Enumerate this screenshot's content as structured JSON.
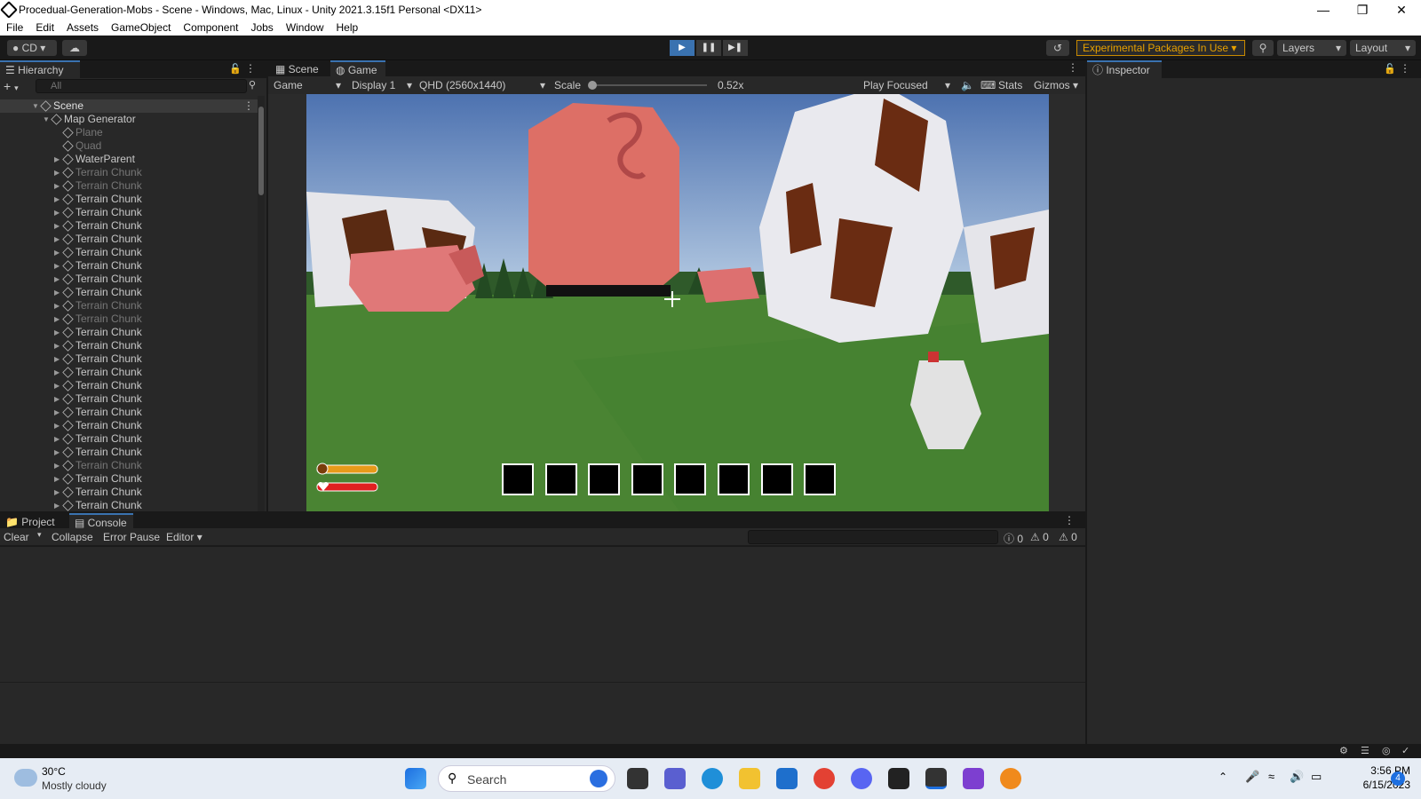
{
  "window": {
    "title": "Procedual-Generation-Mobs - Scene - Windows, Mac, Linux - Unity 2021.3.15f1 Personal <DX11>"
  },
  "menu": [
    "File",
    "Edit",
    "Assets",
    "GameObject",
    "Component",
    "Jobs",
    "Window",
    "Help"
  ],
  "toolbar": {
    "account": "CD",
    "experimental": "Experimental Packages In Use",
    "layers": "Layers",
    "layout": "Layout"
  },
  "hierarchy": {
    "tab": "Hierarchy",
    "search_placeholder": "All",
    "scene": "Scene",
    "items": [
      {
        "label": "Map Generator",
        "depth": 1,
        "expanded": true,
        "dim": false
      },
      {
        "label": "Plane",
        "depth": 2,
        "dim": true
      },
      {
        "label": "Quad",
        "depth": 2,
        "dim": true
      },
      {
        "label": "WaterParent",
        "depth": 2,
        "dim": false
      },
      {
        "label": "Terrain Chunk",
        "depth": 2,
        "dim": true
      },
      {
        "label": "Terrain Chunk",
        "depth": 2,
        "dim": true
      },
      {
        "label": "Terrain Chunk",
        "depth": 2,
        "dim": false
      },
      {
        "label": "Terrain Chunk",
        "depth": 2,
        "dim": false
      },
      {
        "label": "Terrain Chunk",
        "depth": 2,
        "dim": false
      },
      {
        "label": "Terrain Chunk",
        "depth": 2,
        "dim": false
      },
      {
        "label": "Terrain Chunk",
        "depth": 2,
        "dim": false
      },
      {
        "label": "Terrain Chunk",
        "depth": 2,
        "dim": false
      },
      {
        "label": "Terrain Chunk",
        "depth": 2,
        "dim": false
      },
      {
        "label": "Terrain Chunk",
        "depth": 2,
        "dim": false
      },
      {
        "label": "Terrain Chunk",
        "depth": 2,
        "dim": true
      },
      {
        "label": "Terrain Chunk",
        "depth": 2,
        "dim": true
      },
      {
        "label": "Terrain Chunk",
        "depth": 2,
        "dim": false
      },
      {
        "label": "Terrain Chunk",
        "depth": 2,
        "dim": false
      },
      {
        "label": "Terrain Chunk",
        "depth": 2,
        "dim": false
      },
      {
        "label": "Terrain Chunk",
        "depth": 2,
        "dim": false
      },
      {
        "label": "Terrain Chunk",
        "depth": 2,
        "dim": false
      },
      {
        "label": "Terrain Chunk",
        "depth": 2,
        "dim": false
      },
      {
        "label": "Terrain Chunk",
        "depth": 2,
        "dim": false
      },
      {
        "label": "Terrain Chunk",
        "depth": 2,
        "dim": false
      },
      {
        "label": "Terrain Chunk",
        "depth": 2,
        "dim": false
      },
      {
        "label": "Terrain Chunk",
        "depth": 2,
        "dim": false
      },
      {
        "label": "Terrain Chunk",
        "depth": 2,
        "dim": true
      },
      {
        "label": "Terrain Chunk",
        "depth": 2,
        "dim": false
      },
      {
        "label": "Terrain Chunk",
        "depth": 2,
        "dim": false
      },
      {
        "label": "Terrain Chunk",
        "depth": 2,
        "dim": false
      }
    ]
  },
  "center_tabs": {
    "scene": "Scene",
    "game": "Game"
  },
  "gamebar": {
    "mode": "Game",
    "display": "Display 1",
    "resolution": "QHD (2560x1440)",
    "scale_label": "Scale",
    "scale_value": "0.52x",
    "play_focused": "Play Focused",
    "stats": "Stats",
    "gizmos": "Gizmos"
  },
  "inspector": {
    "tab": "Inspector"
  },
  "bottom_tabs": {
    "project": "Project",
    "console": "Console"
  },
  "console": {
    "clear": "Clear",
    "collapse": "Collapse",
    "error_pause": "Error Pause",
    "editor": "Editor",
    "log_count": "0",
    "warn_count": "0",
    "error_count": "0"
  },
  "hud": {
    "hunger": 1.0,
    "health": 1.0,
    "slots": 8
  },
  "taskbar": {
    "temperature": "30°C",
    "weather": "Mostly cloudy",
    "search": "Search",
    "time": "3:56 PM",
    "date": "6/15/2023",
    "notifications": "4"
  }
}
